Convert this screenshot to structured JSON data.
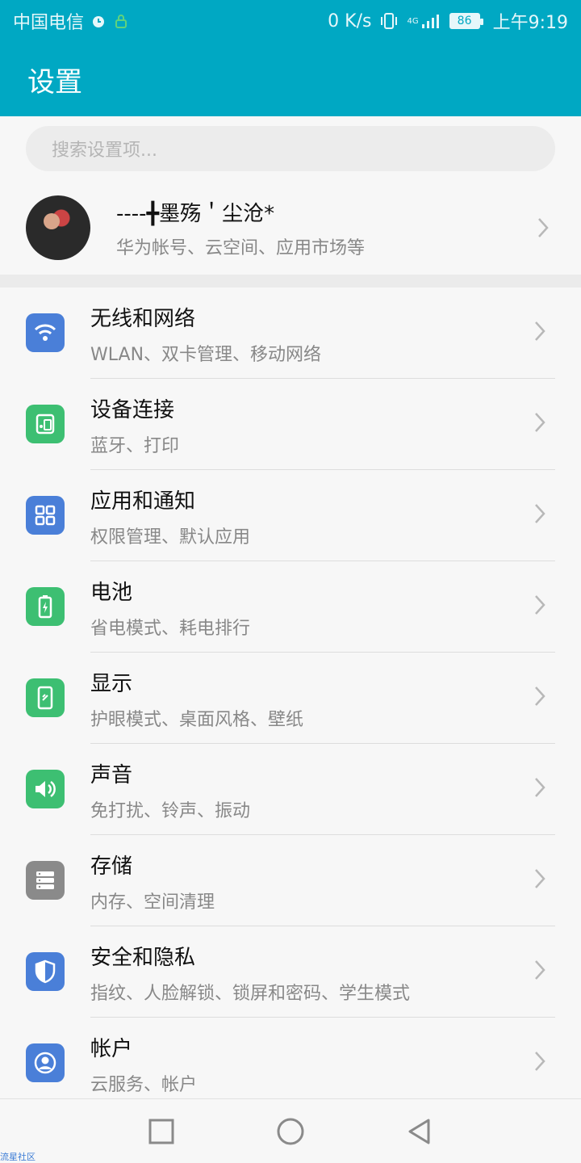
{
  "statusbar": {
    "carrier": "中国电信",
    "net_speed": "0 K/s",
    "network_type": "4G",
    "battery": "86",
    "time": "上午9:19"
  },
  "appbar": {
    "title": "设置"
  },
  "search": {
    "placeholder": "搜索设置项..."
  },
  "account": {
    "name": "----╋墨殇＇尘沧*",
    "subtitle": "华为帐号、云空间、应用市场等"
  },
  "settings": [
    {
      "title": "无线和网络",
      "subtitle": "WLAN、双卡管理、移动网络",
      "icon": "wifi-icon",
      "color": "#4a7fd8"
    },
    {
      "title": "设备连接",
      "subtitle": "蓝牙、打印",
      "icon": "device-connection-icon",
      "color": "#3dbf72"
    },
    {
      "title": "应用和通知",
      "subtitle": "权限管理、默认应用",
      "icon": "apps-grid-icon",
      "color": "#4a7fd8"
    },
    {
      "title": "电池",
      "subtitle": "省电模式、耗电排行",
      "icon": "battery-icon",
      "color": "#3dbf72"
    },
    {
      "title": "显示",
      "subtitle": "护眼模式、桌面风格、壁纸",
      "icon": "display-icon",
      "color": "#3dbf72"
    },
    {
      "title": "声音",
      "subtitle": "免打扰、铃声、振动",
      "icon": "speaker-icon",
      "color": "#3dbf72"
    },
    {
      "title": "存储",
      "subtitle": "内存、空间清理",
      "icon": "storage-icon",
      "color": "#8a8a8a"
    },
    {
      "title": "安全和隐私",
      "subtitle": "指纹、人脸解锁、锁屏和密码、学生模式",
      "icon": "shield-icon",
      "color": "#4a7fd8"
    },
    {
      "title": "帐户",
      "subtitle": "云服务、帐户",
      "icon": "account-icon",
      "color": "#4a7fd8"
    }
  ],
  "watermark": "流星社区"
}
